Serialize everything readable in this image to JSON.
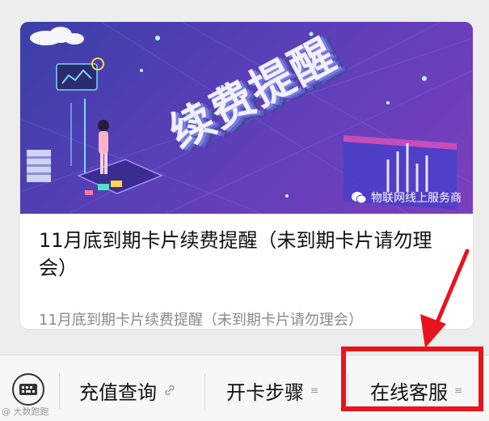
{
  "article": {
    "banner_title": "续费提醒",
    "watermark": "物联网线上服务商",
    "title": "11月底到期卡片续费提醒（未到期卡片请勿理会）",
    "subtitle": "11月底到期卡片续费提醒（未到期卡片请勿理会）"
  },
  "menu": {
    "keyboard_icon": "keyboard-icon",
    "items": [
      {
        "label": "充值查询",
        "icon": "link-icon"
      },
      {
        "label": "开卡步骤",
        "suffix": "≡"
      },
      {
        "label": "在线客服",
        "suffix": "≡"
      }
    ]
  },
  "corner_watermark": "@ 大数跑跑",
  "colors": {
    "background": "#ededed",
    "annotation_red": "#e8141c",
    "banner_purple": "#5a3fb8"
  }
}
